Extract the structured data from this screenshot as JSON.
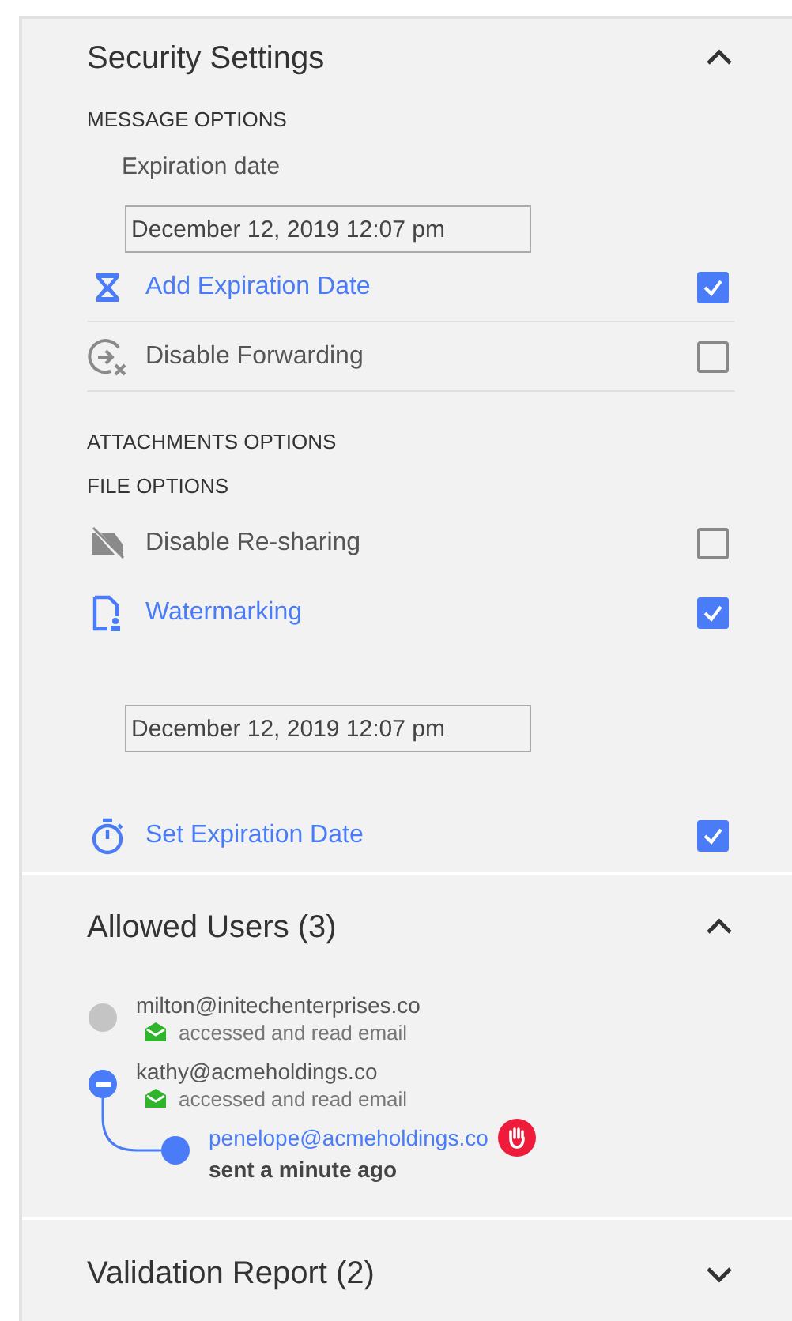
{
  "security_settings": {
    "title": "Security Settings",
    "expanded": true,
    "items": [
      {
        "kind": "heading",
        "text": "MESSAGE OPTIONS"
      },
      {
        "kind": "label",
        "text": "Expiration date"
      },
      {
        "kind": "field",
        "value": "December 12, 2019 12:07 pm"
      },
      {
        "kind": "option",
        "label": "Add Expiration Date",
        "checked": true,
        "divider": true
      },
      {
        "kind": "option",
        "label": "Disable Forwarding",
        "checked": false,
        "divider": true
      },
      {
        "kind": "heading",
        "text": "ATTACHMENTS OPTIONS"
      },
      {
        "kind": "heading",
        "text": "FILE OPTIONS"
      },
      {
        "kind": "option",
        "label": "Disable Re-sharing",
        "checked": false,
        "divider": false
      },
      {
        "kind": "option",
        "label": "Watermarking",
        "checked": true,
        "divider": false
      },
      {
        "kind": "field",
        "value": "December 12, 2019 12:07 pm"
      },
      {
        "kind": "option",
        "label": "Set Expiration Date",
        "checked": true,
        "divider": false
      }
    ]
  },
  "allowed_users": {
    "title": "Allowed Users (3)",
    "expanded": true,
    "users": [
      {
        "kind": "read",
        "email": "milton@initechenterprises.co",
        "status": "accessed and read email",
        "color": "#c4c4c4",
        "expanded": false
      },
      {
        "kind": "read",
        "email": "kathy@acmeholdings.co",
        "status": "accessed and read email",
        "color": "#4a7cf7",
        "expanded": true,
        "children": [
          {
            "kind": "sent",
            "email": "penelope@acmeholdings.co",
            "status": "sent a minute ago",
            "color": "#4a7cf7",
            "expanded": false
          }
        ]
      }
    ]
  },
  "validation_report": {
    "title": "Validation Report (2)",
    "expanded": false
  }
}
